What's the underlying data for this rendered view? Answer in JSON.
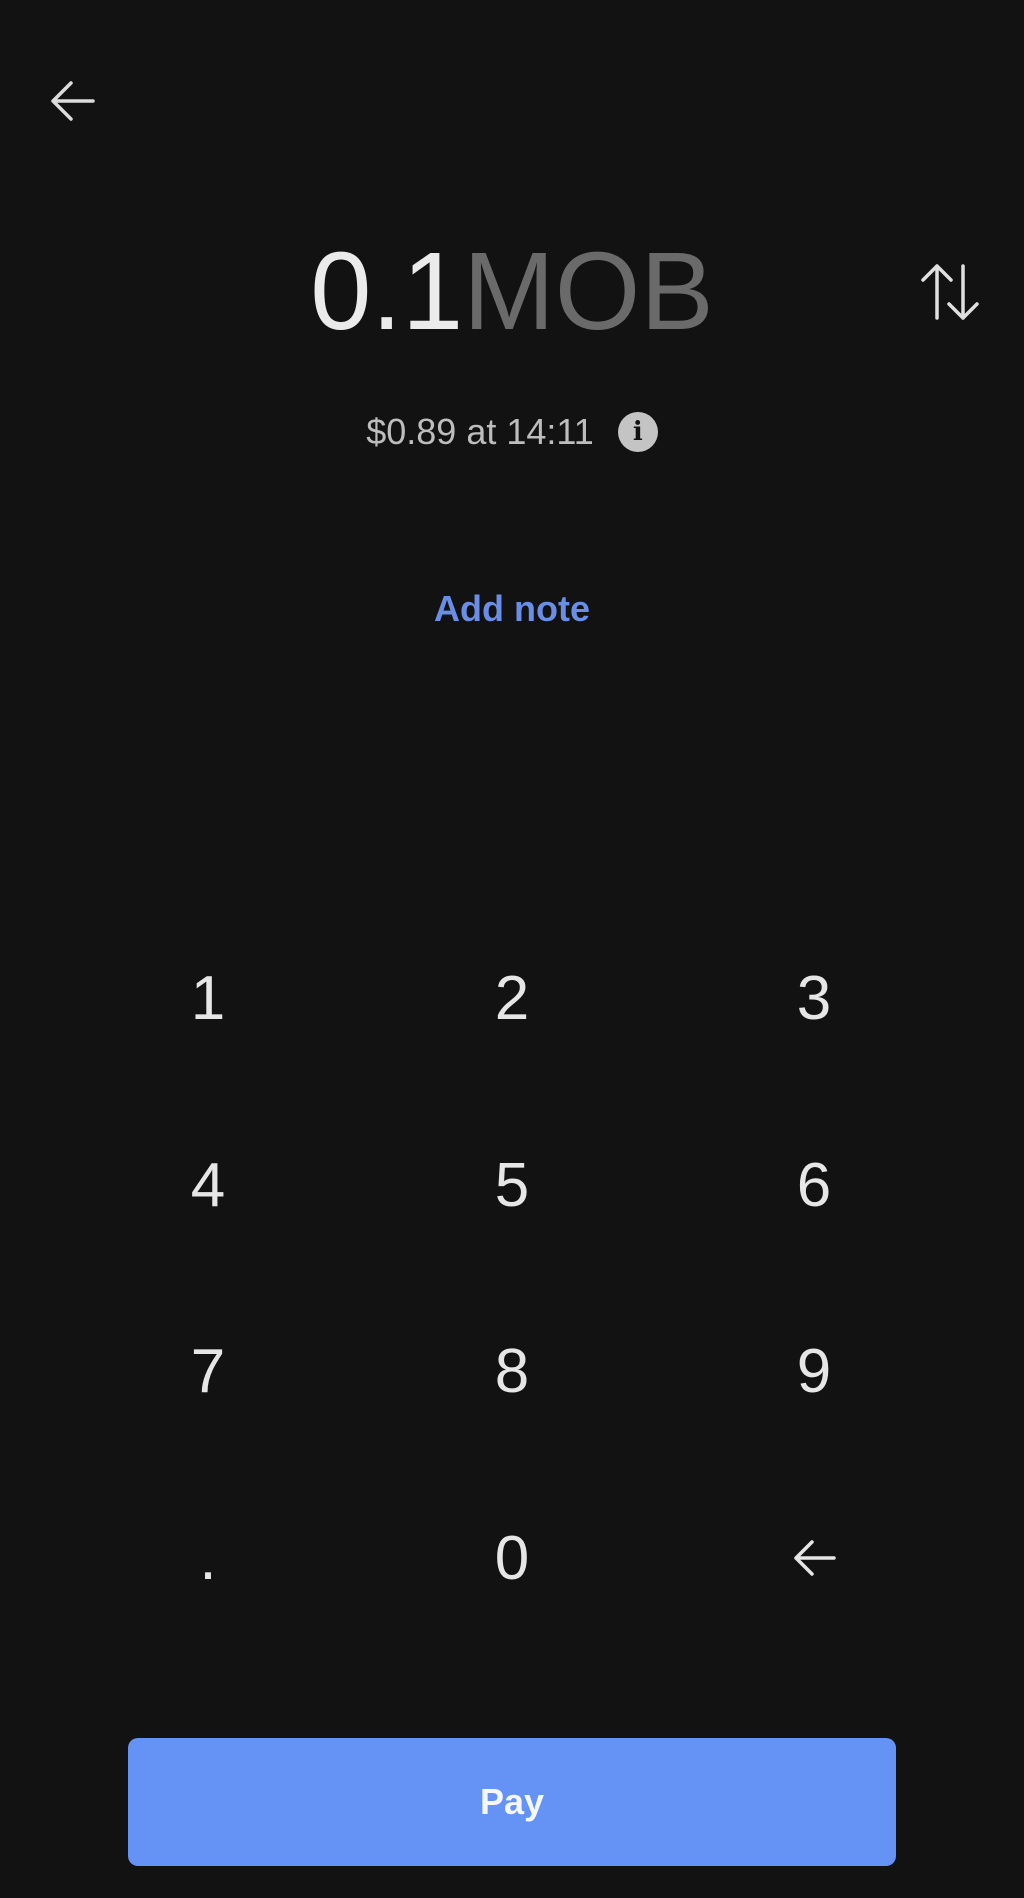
{
  "header": {
    "back_icon": "arrow-left-icon",
    "swap_icon": "swap-vertical-icon"
  },
  "amount": {
    "value": "0.1",
    "currency": "MOB"
  },
  "fiat": {
    "text": "$0.89 at 14:11",
    "info_icon": "info-icon",
    "info_glyph": "i"
  },
  "note": {
    "label": "Add note"
  },
  "keypad": {
    "k1": "1",
    "k2": "2",
    "k3": "3",
    "k4": "4",
    "k5": "5",
    "k6": "6",
    "k7": "7",
    "k8": "8",
    "k9": "9",
    "dot": ".",
    "k0": "0",
    "backspace_icon": "backspace-arrow-icon"
  },
  "pay": {
    "label": "Pay"
  },
  "colors": {
    "background": "#121213",
    "accent": "#6593f5",
    "link": "#6a8de6",
    "currency_muted": "#6a6a6a"
  }
}
